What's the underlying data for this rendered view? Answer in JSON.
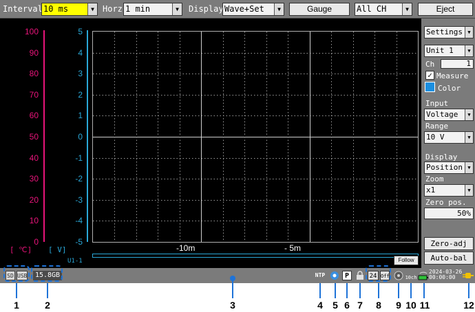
{
  "toolbar": {
    "interval_label": "Interval",
    "interval_value": "10 ms",
    "horz_label": "Horz",
    "horz_value": "1 min",
    "display_label": "Display",
    "display_value": "Wave+Set",
    "gauge_button": "Gauge",
    "channel_value": "All CH",
    "eject_button": "Eject"
  },
  "axes": {
    "temp_ticks": [
      "100",
      "90",
      "80",
      "70",
      "60",
      "50",
      "40",
      "30",
      "20",
      "10",
      "0"
    ],
    "volt_ticks": [
      "5",
      "4",
      "3",
      "2",
      "1",
      "0",
      "-1",
      "-2",
      "-3",
      "-4",
      "-5"
    ],
    "temp_unit": "[   ℃]",
    "volt_unit": "[   V]",
    "channel_tag": "U1-1",
    "x_labels": [
      "-10m",
      "- 5m"
    ],
    "colors": {
      "temp": "#e8147a",
      "volt": "#2aa8d8"
    }
  },
  "follow_button": "Follow",
  "side_panel": {
    "settings_value": "Settings",
    "unit_value": "Unit 1",
    "ch_label": "Ch",
    "ch_value": "1",
    "measure_label": "Measure",
    "measure_checked": "✓",
    "color_label": "Color",
    "channel_color": "#1b8fe0",
    "input_label": "Input",
    "input_value": "Voltage",
    "range_label": "Range",
    "range_value": "10 V",
    "display_label": "Display",
    "display_value": "Position",
    "zoom_label": "Zoom",
    "zoom_value": "x1",
    "zero_pos_label": "Zero pos.",
    "zero_pos_value": "50%",
    "zero_adj_button": "Zero-adj",
    "auto_bal_button": "Auto-bal"
  },
  "status_bar": {
    "sd_label": "SD",
    "usb_label": "USB",
    "capacity": "15.8GB",
    "ntp_label": "NTP",
    "p_label": "P",
    "clock_24": "24",
    "off_label": "Off",
    "count_label": "10ch",
    "date": "2024-03-26",
    "time": "00:00:00"
  },
  "callouts": [
    "1",
    "2",
    "3",
    "4",
    "5",
    "6",
    "7",
    "8",
    "9",
    "10",
    "11",
    "12"
  ],
  "icons": [
    "sd-card-icon",
    "usb-icon",
    "cloud-icon",
    "lock-icon",
    "wireless-icon",
    "battery-icon",
    "ac-power-icon"
  ]
}
